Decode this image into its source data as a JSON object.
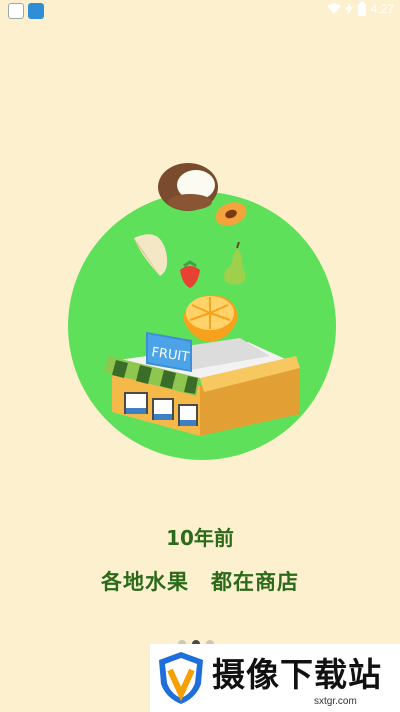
{
  "status_bar": {
    "time": "4:27",
    "icons": [
      "app-icon",
      "browser-icon",
      "wifi-icon",
      "charging-icon",
      "battery-icon"
    ]
  },
  "onboarding": {
    "illustration": "fruit-shop",
    "shop_sign": "FRUIT",
    "line1": "10年前",
    "line2": "各地水果　都在商店",
    "page_count": 3,
    "active_page": 2
  },
  "watermark": {
    "title": "摄像下载站",
    "url": "sxtgr.com"
  },
  "colors": {
    "background": "#fdf0cf",
    "circle": "#5fe05a",
    "text": "#2a6a1a"
  }
}
